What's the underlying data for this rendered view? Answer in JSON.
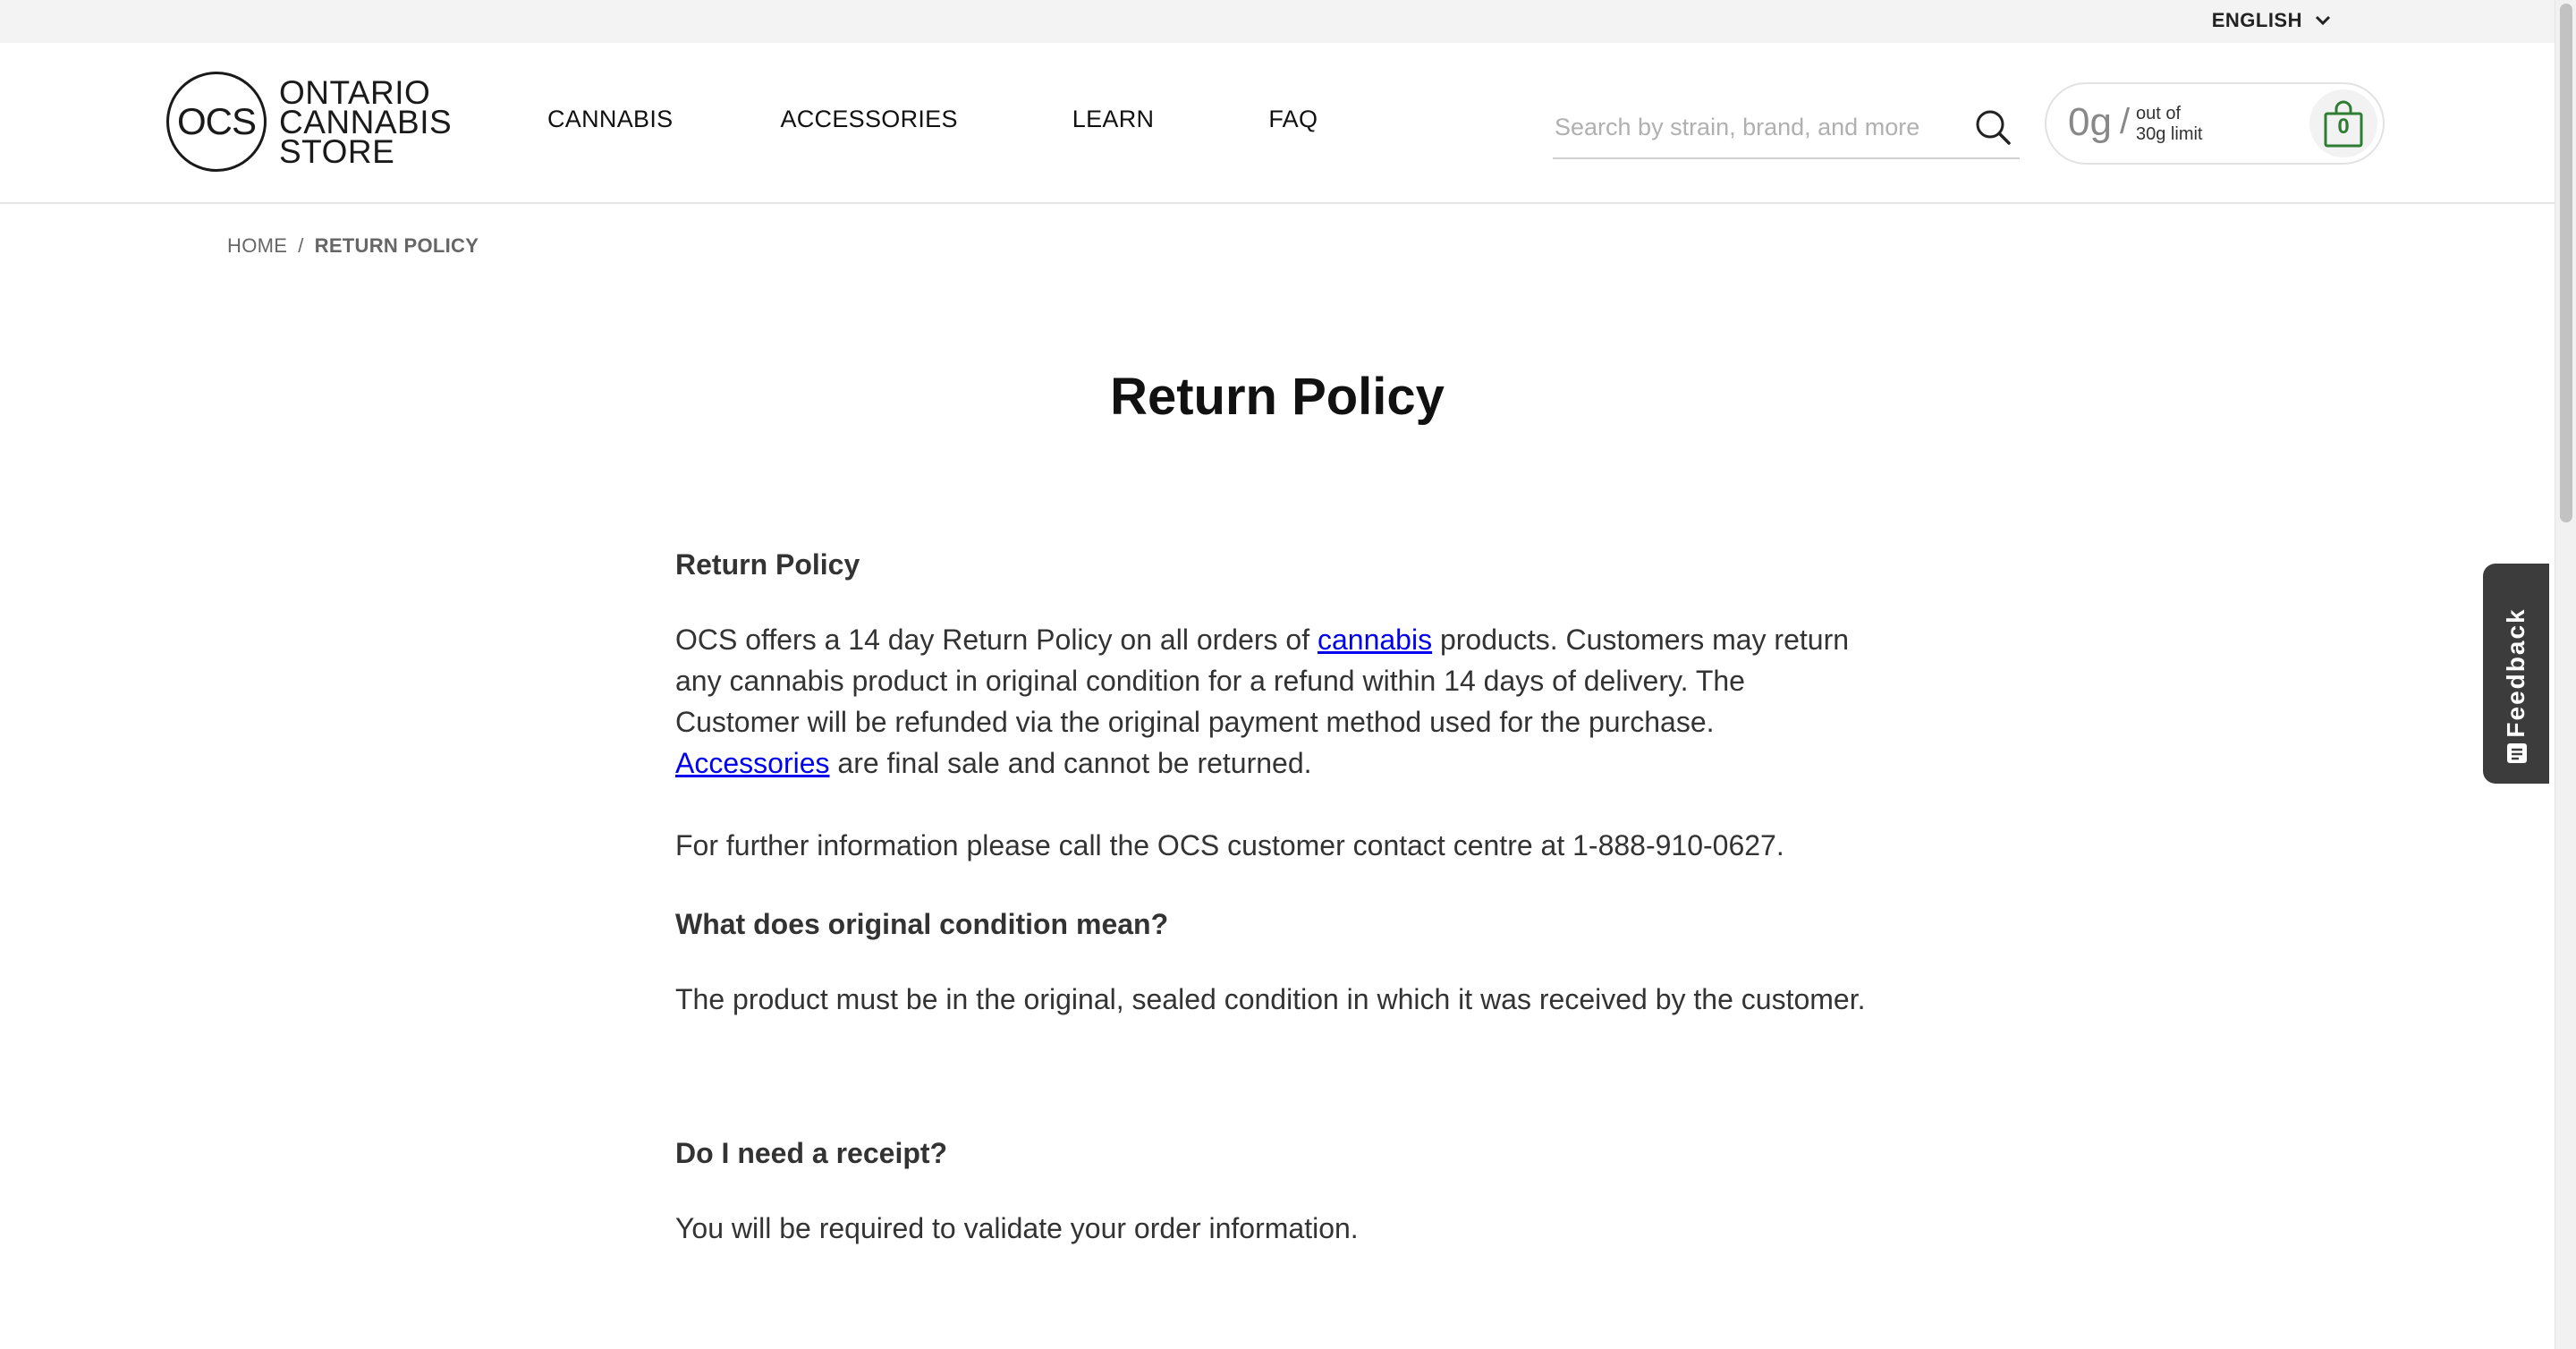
{
  "topbar": {
    "language_label": "ENGLISH"
  },
  "header": {
    "logo": {
      "mark": "OCS",
      "line1": "ONTARIO",
      "line2": "CANNABIS",
      "line3": "STORE"
    },
    "nav": [
      {
        "label": "CANNABIS"
      },
      {
        "label": "ACCESSORIES"
      },
      {
        "label": "LEARN"
      },
      {
        "label": "FAQ"
      }
    ],
    "search": {
      "placeholder": "Search by strain, brand, and more",
      "value": ""
    },
    "cart": {
      "grams": "0g",
      "separator": "/",
      "limit_line1": "out of",
      "limit_line2": "30g limit",
      "item_count": "0"
    }
  },
  "breadcrumb": {
    "home": "HOME",
    "separator": "/",
    "current": "RETURN POLICY"
  },
  "main": {
    "title": "Return Policy",
    "section1_heading": "Return Policy",
    "para1_part1": "OCS offers a 14 day Return Policy on all orders of ",
    "para1_link1": "cannabis",
    "para1_part2": " products. Customers may return any cannabis product in original condition for a refund within 14 days of delivery. The Customer will be refunded via the original payment method used for the purchase. ",
    "para1_link2": "Accessories",
    "para1_part3": " are final sale and cannot be returned.",
    "para2": "For further information please call the OCS customer contact centre at 1-888-910-0627.",
    "section2_heading": "What does original condition mean?",
    "para3": "The product must be in the original, sealed condition in which it was received by the customer.",
    "section3_heading": "Do I need a receipt?",
    "para4": "You will be required to validate your order information."
  },
  "feedback": {
    "label": "Feedback"
  },
  "colors": {
    "topbar_bg": "#f3f3f3",
    "link": "#0000ee",
    "feedback_bg": "#3c3c3c",
    "bag_green": "#2e7d32"
  }
}
